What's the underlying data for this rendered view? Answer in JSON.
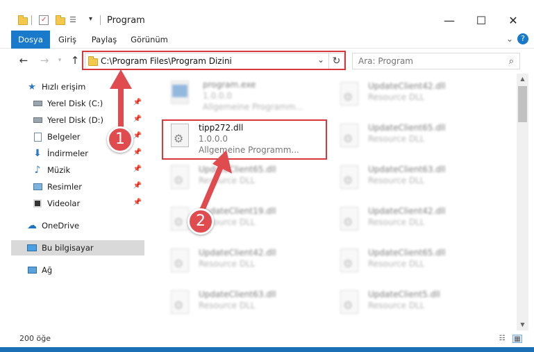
{
  "window": {
    "title": "Program",
    "minimize": "—",
    "maximize": "☐",
    "close": "✕"
  },
  "ribbon": {
    "tabs": [
      {
        "label": "Dosya",
        "active": true
      },
      {
        "label": "Giriş",
        "active": false
      },
      {
        "label": "Paylaş",
        "active": false
      },
      {
        "label": "Görünüm",
        "active": false
      }
    ],
    "help": "?"
  },
  "nav": {
    "back": "←",
    "forward": "→",
    "up": "↑",
    "address": "C:\\Program Files\\Program Dizini",
    "address_dropdown": "⌄",
    "refresh": "↻",
    "search_placeholder": "Ara: Program"
  },
  "sidebar": {
    "items": [
      {
        "label": "Hızlı erişim",
        "icon": "star-icon",
        "pinned": false
      },
      {
        "label": "Yerel Disk (C:)",
        "icon": "drive-icon",
        "pinned": true
      },
      {
        "label": "Yerel Disk (D:)",
        "icon": "drive-icon",
        "pinned": true
      },
      {
        "label": "Belgeler",
        "icon": "documents-icon",
        "pinned": true
      },
      {
        "label": "İndirmeler",
        "icon": "download-icon",
        "pinned": true
      },
      {
        "label": "Müzik",
        "icon": "music-icon",
        "pinned": true
      },
      {
        "label": "Resimler",
        "icon": "pictures-icon",
        "pinned": true
      },
      {
        "label": "Videolar",
        "icon": "video-icon",
        "pinned": true
      },
      {
        "label": "OneDrive",
        "icon": "cloud-icon",
        "pinned": false
      },
      {
        "label": "Bu bilgisayar",
        "icon": "computer-icon",
        "pinned": false,
        "selected": true
      },
      {
        "label": "Ağ",
        "icon": "network-icon",
        "pinned": false
      }
    ]
  },
  "files": {
    "left": [
      {
        "name": "program.exe",
        "line2": "1.0.0.0",
        "line3": "Allgemeine Programm...",
        "blurred": true
      },
      {
        "name": "tipp272.dll",
        "line2": "1.0.0.0",
        "line3": "Allgemeine Programm...",
        "blurred": false
      },
      {
        "name": "UpdateClient65.dll",
        "line2": "Resource DLL",
        "line3": "",
        "blurred": true
      },
      {
        "name": "UpdateClient19.dll",
        "line2": "Resource DLL",
        "line3": "",
        "blurred": true
      },
      {
        "name": "UpdateClient42.dll",
        "line2": "Resource DLL",
        "line3": "",
        "blurred": true
      },
      {
        "name": "UpdateClient63.dll",
        "line2": "Resource DLL",
        "line3": "",
        "blurred": true
      }
    ],
    "right": [
      {
        "name": "UpdateClient42.dll",
        "line2": "Resource DLL"
      },
      {
        "name": "UpdateClient65.dll",
        "line2": "Resource DLL"
      },
      {
        "name": "UpdateClient63.dll",
        "line2": "Resource DLL"
      },
      {
        "name": "UpdateClient42.dll",
        "line2": "Resource DLL"
      },
      {
        "name": "UpdateClient65.dll",
        "line2": "Resource DLL"
      },
      {
        "name": "UpdateClient5.dll",
        "line2": "Resource DLL"
      }
    ]
  },
  "status": {
    "count": "200 öğe"
  },
  "annotations": {
    "badge1": "1",
    "badge2": "2",
    "color": "#d9363e"
  }
}
